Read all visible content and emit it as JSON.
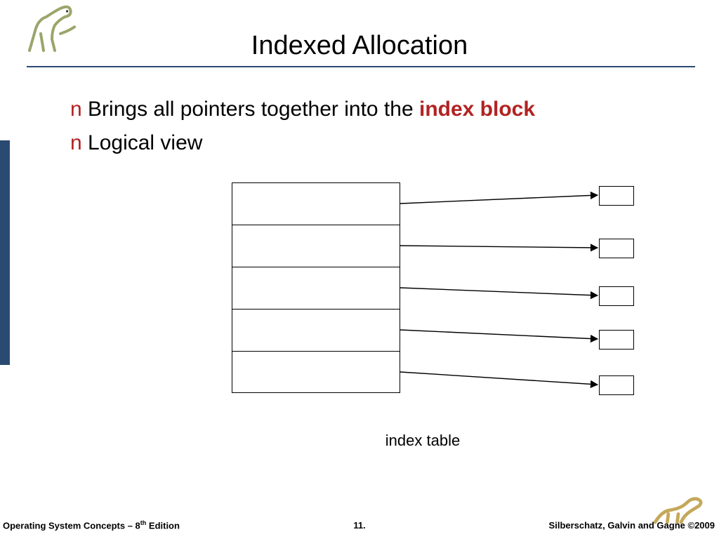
{
  "title": "Indexed Allocation",
  "bullets": {
    "b1_pre": "Brings all pointers together into the ",
    "b1_em": "index block",
    "b2": "Logical view"
  },
  "bullet_marker": "n",
  "diagram": {
    "label": "index table",
    "rows": 5,
    "blocks": 5
  },
  "footer": {
    "left_pre": "Operating System Concepts – 8",
    "left_sup": "th",
    "left_post": " Edition",
    "mid": "11.",
    "right": "Silberschatz, Galvin and Gagne ©2009"
  }
}
